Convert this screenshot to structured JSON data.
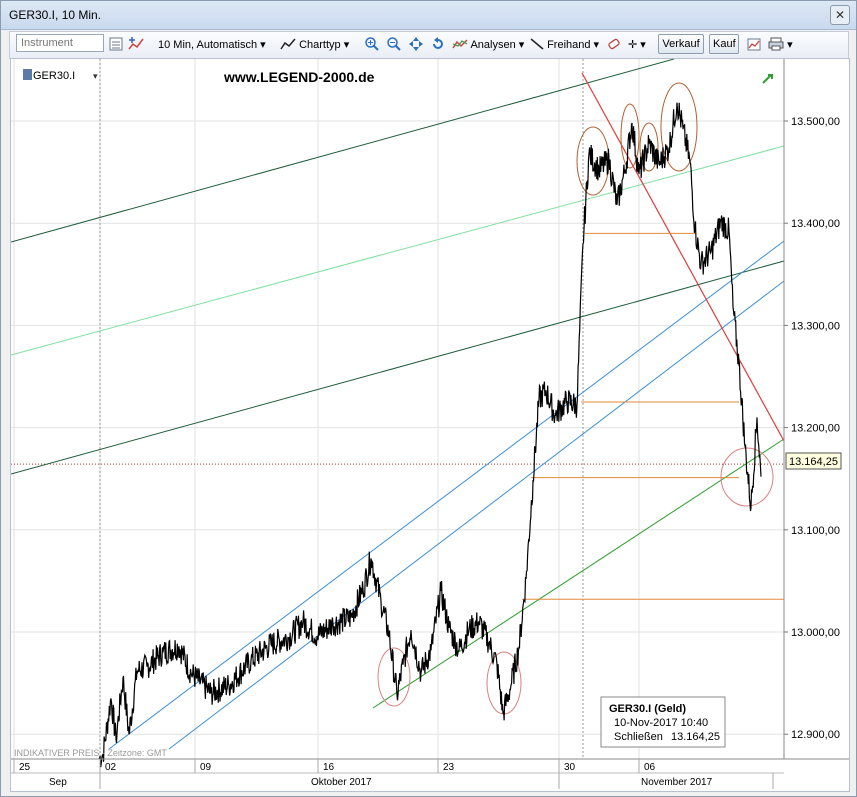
{
  "window": {
    "title": "GER30.I, 10 Min."
  },
  "toolbar": {
    "instrument_placeholder": "Instrument",
    "period": "10 Min,",
    "mode": "Automatisch",
    "chart_type": "Charttyp",
    "analyses": "Analysen",
    "freehand": "Freihand",
    "sell": "Verkauf",
    "buy": "Kauf"
  },
  "chart": {
    "symbol": "GER30.I",
    "watermark": "www.LEGEND-2000.de",
    "bottom_note": "INDIKATIVER PREIS - Zeitzone: GMT",
    "current_price": "13.164,25",
    "y_ticks": [
      {
        "value": 13500,
        "label": "13.500,00"
      },
      {
        "value": 13400,
        "label": "13.400,00"
      },
      {
        "value": 13300,
        "label": "13.300,00"
      },
      {
        "value": 13200,
        "label": "13.200,00"
      },
      {
        "value": 13100,
        "label": "13.100,00"
      },
      {
        "value": 13000,
        "label": "13.000,00"
      },
      {
        "value": 12900,
        "label": "12.900,00"
      }
    ],
    "x_day_labels": [
      "25",
      "02",
      "09",
      "16",
      "23",
      "30",
      "06"
    ],
    "x_month_labels": [
      "Sep",
      "Oktober 2017",
      "November 2017"
    ],
    "info_box": {
      "title": "GER30.I (Geld)",
      "date": "10-Nov-2017 10:40",
      "close_label": "Schließen",
      "close_value": "13.164,25"
    },
    "colors": {
      "price": "#000000",
      "dark_green_lines": "#1e5c3a",
      "light_green_line": "#7fe0a0",
      "blue_lines": "#3a8fd6",
      "green_support": "#2ea02e",
      "red_line": "#e23b3b",
      "orange_levels": "#e08a3a",
      "ellipses": "#d98080"
    }
  }
}
